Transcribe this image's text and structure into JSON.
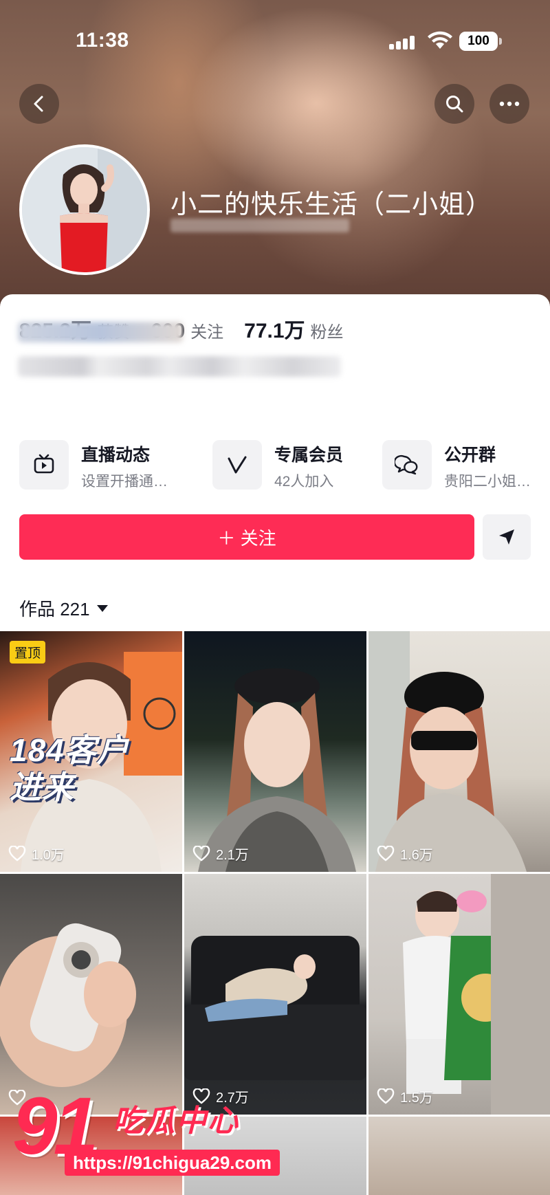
{
  "status_bar": {
    "time": "11:38",
    "battery": "100"
  },
  "profile": {
    "nickname": "小二的快乐生活（二小姐）",
    "stats": [
      {
        "value": "825.2万",
        "label": "获赞"
      },
      {
        "value": "600",
        "label": "关注"
      },
      {
        "value": "77.1万",
        "label": "粉丝"
      }
    ]
  },
  "features": [
    {
      "title": "直播动态",
      "subtitle": "设置开播通…",
      "icon": "live-tv-icon"
    },
    {
      "title": "专属会员",
      "subtitle": "42人加入",
      "icon": "v-member-icon"
    },
    {
      "title": "公开群",
      "subtitle": "贵阳二小姐…",
      "icon": "group-chat-icon"
    }
  ],
  "actions": {
    "follow_label": "＋ 关注"
  },
  "works": {
    "label": "作品 221"
  },
  "videos": [
    {
      "likes": "1.0万",
      "pinned_label": "置顶",
      "overlay_line1": "184客户",
      "overlay_line2": "进来"
    },
    {
      "likes": "2.1万"
    },
    {
      "likes": "1.6万"
    },
    {
      "likes": ""
    },
    {
      "likes": "2.7万"
    },
    {
      "likes": "1.5万"
    }
  ],
  "watermark": {
    "number": "91",
    "text": "吃瓜中心",
    "url": "https://91chigua29.com"
  },
  "colors": {
    "accent": "#fe2c55",
    "pin": "#facc15"
  }
}
